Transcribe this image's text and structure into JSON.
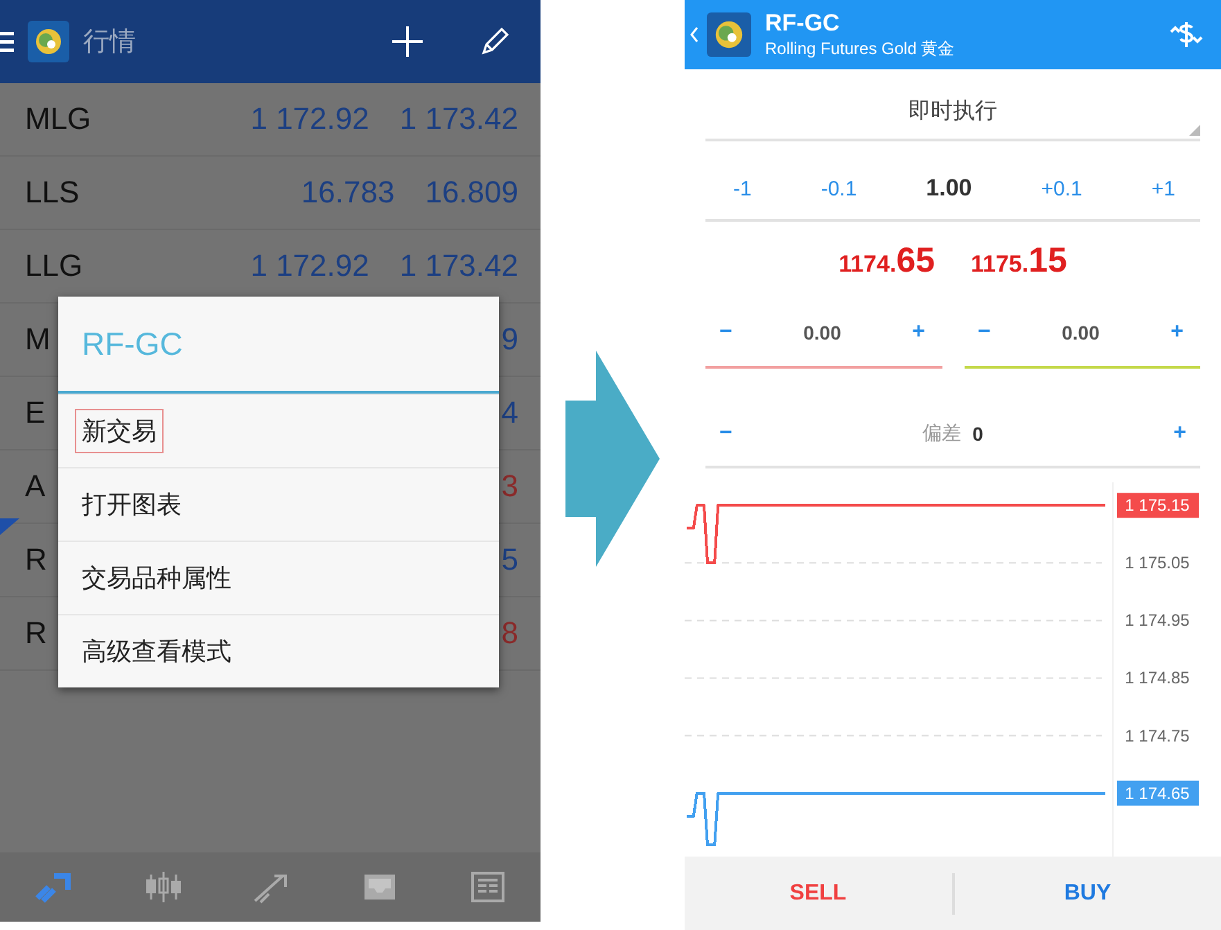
{
  "left_screen": {
    "app_bar": {
      "title": "行情"
    },
    "quotes": [
      {
        "symbol": "MLG",
        "prices": [
          {
            "text": "1 172.92",
            "color": "#1c3f82"
          },
          {
            "text": "1 173.42",
            "color": "#1c3f82"
          }
        ]
      },
      {
        "symbol": "LLS",
        "prices": [
          {
            "text": "16.783",
            "color": "#1c3f82"
          },
          {
            "text": "16.809",
            "color": "#1c3f82"
          }
        ]
      },
      {
        "symbol": "LLG",
        "prices": [
          {
            "text": "1 172.92",
            "color": "#1c3f82"
          },
          {
            "text": "1 173.42",
            "color": "#1c3f82"
          }
        ]
      },
      {
        "symbol": "M",
        "prices": [
          {
            "text": "9",
            "color": "#1c3f82"
          }
        ]
      },
      {
        "symbol": "E",
        "prices": [
          {
            "text": "4",
            "color": "#1c3f82"
          }
        ]
      },
      {
        "symbol": "A",
        "prices": [
          {
            "text": "3",
            "color": "#8a2a2a"
          }
        ]
      },
      {
        "symbol": "R",
        "prices": [
          {
            "text": "5",
            "color": "#1c3f82"
          }
        ]
      },
      {
        "symbol": "R",
        "prices": [
          {
            "text": "8",
            "color": "#8a2a2a"
          }
        ]
      }
    ],
    "dialog": {
      "title": "RF-GC",
      "items": [
        {
          "label": "新交易",
          "highlighted": true
        },
        {
          "label": "打开图表",
          "highlighted": false
        },
        {
          "label": "交易品种属性",
          "highlighted": false
        },
        {
          "label": "高级查看模式",
          "highlighted": false
        }
      ]
    },
    "bottom_nav": [
      {
        "kind": "quotes",
        "selected": true
      },
      {
        "kind": "chart",
        "selected": false
      },
      {
        "kind": "trade",
        "selected": false
      },
      {
        "kind": "mail",
        "selected": false
      },
      {
        "kind": "news",
        "selected": false
      }
    ]
  },
  "right_screen": {
    "app_bar": {
      "symbol": "RF-GC",
      "description": "Rolling Futures Gold 黄金"
    },
    "order_type": "即时执行",
    "volume": {
      "steps_down": [
        "-1",
        "-0.1"
      ],
      "value": "1.00",
      "steps_up": [
        "+0.1",
        "+1"
      ]
    },
    "prices": [
      {
        "prefix": "1174.",
        "pips": "65"
      },
      {
        "prefix": "1175.",
        "pips": "15"
      }
    ],
    "stops": [
      {
        "minus": "−",
        "value": "0.00",
        "plus": "+",
        "kind": "sl"
      },
      {
        "minus": "−",
        "value": "0.00",
        "plus": "+",
        "kind": "tp"
      }
    ],
    "deviation": {
      "minus": "−",
      "label": "偏差",
      "value": "0",
      "plus": "+"
    },
    "chart_data": {
      "type": "line",
      "grid": true,
      "ylim": [
        1174.54,
        1175.19
      ],
      "categories": [
        null,
        null,
        null,
        null,
        null,
        null,
        null,
        null,
        null,
        null,
        null,
        null,
        null,
        null,
        null,
        null,
        null,
        null,
        null,
        null,
        null,
        null,
        null,
        null,
        null,
        null,
        null,
        null,
        null,
        null,
        null,
        null,
        null,
        null,
        null,
        null,
        null,
        null,
        null,
        null,
        null,
        null,
        null,
        null,
        null,
        null,
        null,
        null,
        null,
        null,
        null,
        null,
        null,
        null,
        null,
        null,
        null,
        null,
        null,
        null,
        null,
        null,
        null,
        null,
        null,
        null,
        null,
        null,
        null,
        null,
        null,
        null,
        null,
        null,
        null,
        null,
        null,
        null,
        null,
        null,
        null,
        null,
        null,
        null,
        null,
        null,
        null,
        null,
        null,
        null,
        null,
        null,
        null,
        null,
        null,
        null,
        null,
        null,
        null,
        null,
        null,
        null,
        null,
        null,
        null,
        null,
        null,
        null,
        null,
        null,
        null,
        null,
        null,
        null,
        null,
        null,
        null,
        null,
        null,
        null
      ],
      "series": [
        {
          "color": "#f44b4b",
          "values": [
            1175.11,
            1175.11,
            1175.11,
            1175.15,
            1175.15,
            1175.15,
            1175.05,
            1175.05,
            1175.05,
            1175.15,
            1175.15,
            1175.15,
            1175.15,
            1175.15,
            1175.15,
            1175.15,
            1175.15,
            1175.15,
            1175.15,
            1175.15,
            1175.15,
            1175.15,
            1175.15,
            1175.15,
            1175.15,
            1175.15,
            1175.15,
            1175.15,
            1175.15,
            1175.15,
            1175.15,
            1175.15,
            1175.15,
            1175.15,
            1175.15,
            1175.15,
            1175.15,
            1175.15,
            1175.15,
            1175.15,
            1175.15,
            1175.15,
            1175.15,
            1175.15,
            1175.15,
            1175.15,
            1175.15,
            1175.15,
            1175.15,
            1175.15,
            1175.15,
            1175.15,
            1175.15,
            1175.15,
            1175.15,
            1175.15,
            1175.15,
            1175.15,
            1175.15,
            1175.15,
            1175.15,
            1175.15,
            1175.15,
            1175.15,
            1175.15,
            1175.15,
            1175.15,
            1175.15,
            1175.15,
            1175.15,
            1175.15,
            1175.15,
            1175.15,
            1175.15,
            1175.15,
            1175.15,
            1175.15,
            1175.15,
            1175.15,
            1175.15,
            1175.15,
            1175.15,
            1175.15,
            1175.15,
            1175.15,
            1175.15,
            1175.15,
            1175.15,
            1175.15,
            1175.15,
            1175.15,
            1175.15,
            1175.15,
            1175.15,
            1175.15,
            1175.15,
            1175.15,
            1175.15,
            1175.15,
            1175.15,
            1175.15,
            1175.15,
            1175.15,
            1175.15,
            1175.15,
            1175.15,
            1175.15,
            1175.15,
            1175.15,
            1175.15,
            1175.15,
            1175.15,
            1175.15,
            1175.15,
            1175.15,
            1175.15,
            1175.15,
            1175.15,
            1175.15,
            1175.15
          ]
        },
        {
          "color": "#42a0f0",
          "values": [
            1174.61,
            1174.61,
            1174.61,
            1174.65,
            1174.65,
            1174.65,
            1174.56,
            1174.56,
            1174.56,
            1174.65,
            1174.65,
            1174.65,
            1174.65,
            1174.65,
            1174.65,
            1174.65,
            1174.65,
            1174.65,
            1174.65,
            1174.65,
            1174.65,
            1174.65,
            1174.65,
            1174.65,
            1174.65,
            1174.65,
            1174.65,
            1174.65,
            1174.65,
            1174.65,
            1174.65,
            1174.65,
            1174.65,
            1174.65,
            1174.65,
            1174.65,
            1174.65,
            1174.65,
            1174.65,
            1174.65,
            1174.65,
            1174.65,
            1174.65,
            1174.65,
            1174.65,
            1174.65,
            1174.65,
            1174.65,
            1174.65,
            1174.65,
            1174.65,
            1174.65,
            1174.65,
            1174.65,
            1174.65,
            1174.65,
            1174.65,
            1174.65,
            1174.65,
            1174.65,
            1174.65,
            1174.65,
            1174.65,
            1174.65,
            1174.65,
            1174.65,
            1174.65,
            1174.65,
            1174.65,
            1174.65,
            1174.65,
            1174.65,
            1174.65,
            1174.65,
            1174.65,
            1174.65,
            1174.65,
            1174.65,
            1174.65,
            1174.65,
            1174.65,
            1174.65,
            1174.65,
            1174.65,
            1174.65,
            1174.65,
            1174.65,
            1174.65,
            1174.65,
            1174.65,
            1174.65,
            1174.65,
            1174.65,
            1174.65,
            1174.65,
            1174.65,
            1174.65,
            1174.65,
            1174.65,
            1174.65,
            1174.65,
            1174.65,
            1174.65,
            1174.65,
            1174.65,
            1174.65,
            1174.65,
            1174.65,
            1174.65,
            1174.65,
            1174.65,
            1174.65,
            1174.65,
            1174.65,
            1174.65,
            1174.65,
            1174.65,
            1174.65,
            1174.65,
            1174.65
          ]
        }
      ],
      "yticks": [
        {
          "value": 1175.15,
          "label": "1 175.15"
        },
        {
          "value": 1175.05,
          "label": "1 175.05"
        },
        {
          "value": 1174.95,
          "label": "1 174.95"
        },
        {
          "value": 1174.85,
          "label": "1 174.85"
        },
        {
          "value": 1174.75,
          "label": "1 174.75"
        },
        {
          "value": 1174.65,
          "label": "1 174.65"
        }
      ]
    },
    "actions": [
      {
        "label": "SELL",
        "kind": "sell"
      },
      {
        "label": "BUY",
        "kind": "buy"
      }
    ]
  }
}
